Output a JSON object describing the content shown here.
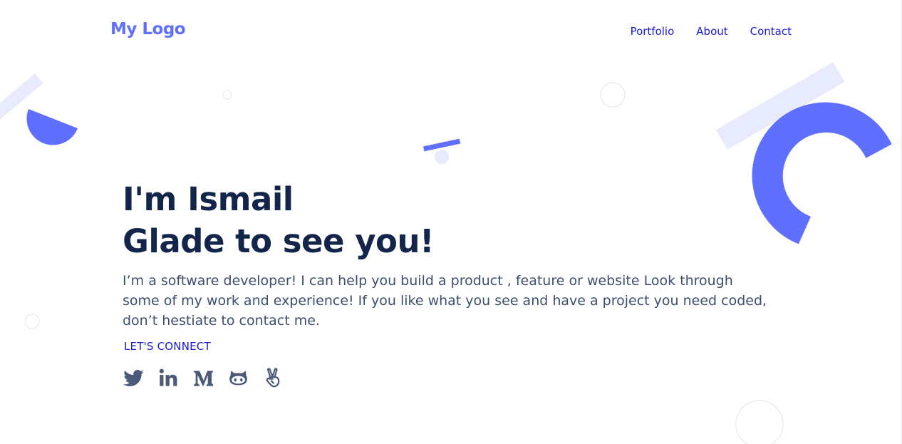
{
  "header": {
    "logo_text": "My Logo",
    "nav": [
      "Portfolio",
      "About",
      "Contact"
    ]
  },
  "hero": {
    "title_line1": "I'm Ismail",
    "title_line2": "Glade to see you!",
    "description": "I’m a software developer! I can help you build a product , feature or website Look through some of my work and experience! If you like what you see and have a project you need coded, don’t hestiate to contact me.",
    "connect_label": "LET'S CONNECT"
  },
  "socials": [
    {
      "icon": "twitter-icon"
    },
    {
      "icon": "linkedin-icon"
    },
    {
      "icon": "medium-icon"
    },
    {
      "icon": "github-icon"
    },
    {
      "icon": "angellist-icon"
    }
  ],
  "colors": {
    "accent": "#5f6fff",
    "accent_light": "#e8eafd",
    "link": "#1a1ad6",
    "heading": "#13254a",
    "body_text": "#3d4f6e",
    "icon": "#4c5a7a"
  }
}
